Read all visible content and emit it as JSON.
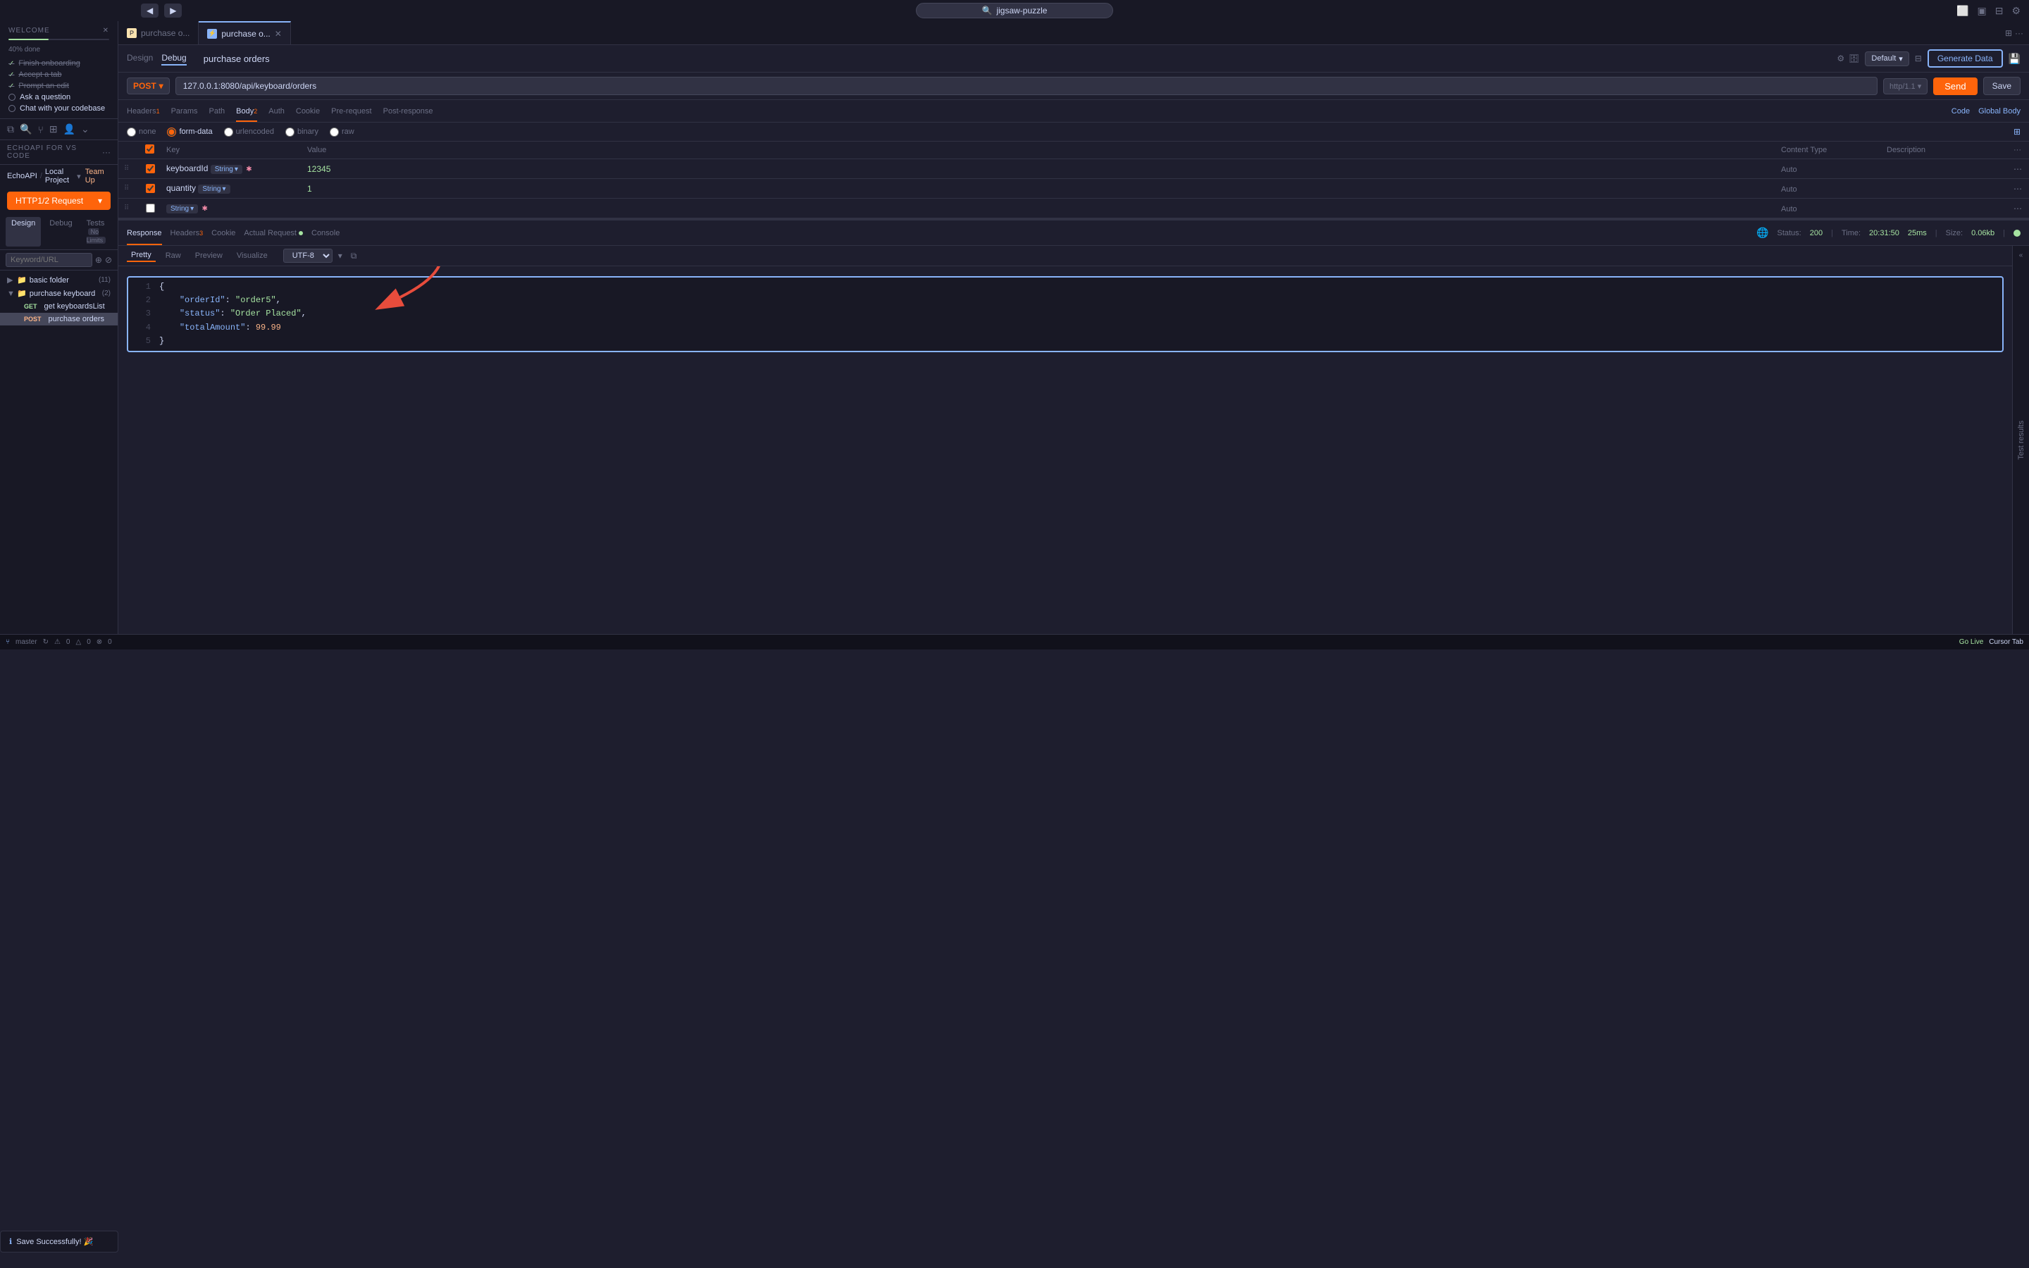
{
  "titlebar": {
    "back_label": "◀",
    "forward_label": "▶",
    "search_placeholder": "jigsaw-puzzle",
    "search_icon": "🔍"
  },
  "tabs": [
    {
      "id": "tab1",
      "label": "purchase o...",
      "icon": "file",
      "active": false,
      "closable": false
    },
    {
      "id": "tab2",
      "label": "purchase o...",
      "icon": "api",
      "active": true,
      "closable": true
    }
  ],
  "request": {
    "nav_tabs": [
      "Design",
      "Debug"
    ],
    "active_nav_tab": "Debug",
    "title": "purchase orders",
    "default_label": "Default",
    "generate_data_label": "Generate Data",
    "method": "POST",
    "url": "127.0.0.1:8080/api/keyboard/orders",
    "protocol": "http/1.1",
    "send_label": "Send",
    "save_label": "Save",
    "body_tabs": [
      {
        "label": "Headers",
        "badge": "1"
      },
      {
        "label": "Params",
        "badge": ""
      },
      {
        "label": "Path",
        "badge": ""
      },
      {
        "label": "Body",
        "badge": "2",
        "active": true
      },
      {
        "label": "Auth",
        "badge": ""
      },
      {
        "label": "Cookie",
        "badge": ""
      },
      {
        "label": "Pre-request",
        "badge": ""
      },
      {
        "label": "Post-response",
        "badge": ""
      }
    ],
    "code_label": "Code",
    "global_body_label": "Global Body",
    "format_options": [
      "none",
      "form-data",
      "urlencoded",
      "binary",
      "raw"
    ],
    "active_format": "form-data",
    "table_headers": [
      "",
      "",
      "Key",
      "Value",
      "Content Type",
      "Description",
      ""
    ],
    "params": [
      {
        "enabled": true,
        "key": "keyboardId",
        "type": "String",
        "required": true,
        "value": "12345",
        "content_type": "Auto",
        "description": ""
      },
      {
        "enabled": true,
        "key": "quantity",
        "type": "String",
        "required": false,
        "value": "1",
        "content_type": "Auto",
        "description": ""
      },
      {
        "enabled": false,
        "key": "",
        "type": "String",
        "required": true,
        "value": "",
        "content_type": "Auto",
        "description": ""
      }
    ]
  },
  "response": {
    "tabs": [
      "Response",
      "Headers",
      "Cookie",
      "Actual Request",
      "Console"
    ],
    "headers_badge": "3",
    "actual_request_dot": true,
    "active_tab": "Response",
    "status_label": "Status:",
    "status_code": "200",
    "time_label": "Time:",
    "time_value": "20:31:50",
    "time_ms": "25ms",
    "size_label": "Size:",
    "size_value": "0.06kb",
    "format_tabs": [
      "Pretty",
      "Raw",
      "Preview",
      "Visualize"
    ],
    "active_format": "Pretty",
    "encoding": "UTF-8",
    "json_lines": [
      {
        "num": 1,
        "content": "{"
      },
      {
        "num": 2,
        "content": "    \"orderId\": \"order5\","
      },
      {
        "num": 3,
        "content": "    \"status\": \"Order Placed\","
      },
      {
        "num": 4,
        "content": "    \"totalAmount\": 99.99"
      },
      {
        "num": 5,
        "content": "}"
      }
    ]
  },
  "sidebar": {
    "welcome_title": "WELCOME",
    "progress_text": "40% done",
    "checklist": [
      {
        "label": "Finish onboarding",
        "done": true
      },
      {
        "label": "Accept a tab",
        "done": true
      },
      {
        "label": "Prompt an edit",
        "done": true
      },
      {
        "label": "Ask a question",
        "done": false
      },
      {
        "label": "Chat with your codebase",
        "done": false
      }
    ],
    "echoapi_title": "ECHOAPI FOR VS CODE",
    "project_label": "EchoAPI",
    "local_project": "Local Project",
    "team_up": "Team Up",
    "http_request_label": "HTTP1/2 Request",
    "design_tab": "Design",
    "debug_tab": "Debug",
    "tests_tab": "Tests",
    "no_limits": "No Limits",
    "search_placeholder": "Keyword/URL",
    "tree": [
      {
        "type": "folder",
        "label": "basic folder",
        "count": 11,
        "indent": 0,
        "collapsed": true
      },
      {
        "type": "folder",
        "label": "purchase keyboard",
        "count": 2,
        "indent": 0,
        "collapsed": false
      },
      {
        "type": "file",
        "method": "GET",
        "label": "get keyboardsList",
        "indent": 1
      },
      {
        "type": "file",
        "method": "POST",
        "label": "purchase orders",
        "indent": 1,
        "selected": true
      }
    ]
  },
  "statusbar": {
    "branch": "master",
    "errors": "0",
    "warnings": "0",
    "ports": "0",
    "go_live": "Go Live",
    "cursor_tab": "Cursor Tab"
  },
  "save_success": "Save Successfully! 🎉",
  "test_results_label": "Test results"
}
